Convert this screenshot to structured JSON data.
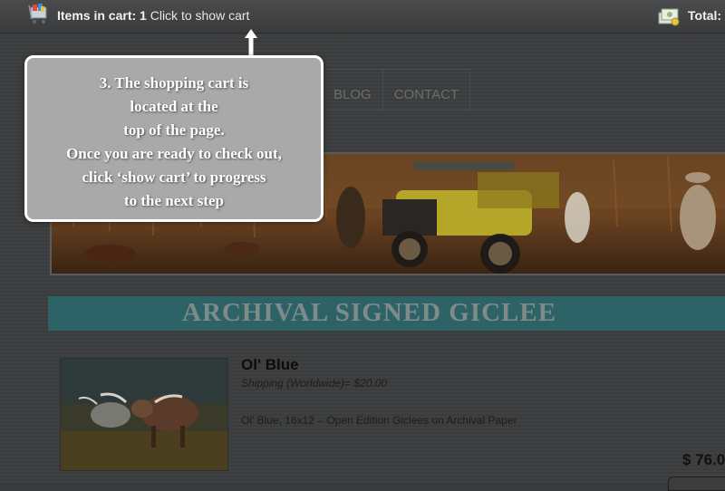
{
  "cart_bar": {
    "items_label": "Items in cart:",
    "items_count": "1",
    "show_cart_link": "Click to show cart",
    "total_label": "Total:"
  },
  "nav": {
    "items": [
      {
        "label": "BLOG"
      },
      {
        "label": "CONTACT"
      }
    ]
  },
  "tooltip": {
    "lines": [
      "3. The shopping cart is",
      "located at the",
      "top of the page.",
      "Once you are ready to check out,",
      "click ‘show cart’ to progress",
      "to the next step"
    ]
  },
  "section": {
    "title": "ARCHIVAL SIGNED GICLEE"
  },
  "product": {
    "name": "Ol' Blue",
    "shipping": "Shipping (Worldwide)= $20.00",
    "description": "Ol' Blue, 16x12 – Open Edition Giclees on Archival Paper",
    "price": "$ 76.0"
  },
  "colors": {
    "overlay_bg": "#3a3b3c",
    "section_bar": "#2d6367",
    "tooltip_bg": "#a9a9a9",
    "tooltip_border": "#ffffff"
  },
  "icons": {
    "cart": "shopping-cart-icon",
    "money": "money-icon",
    "arrow": "up-arrow-icon"
  }
}
